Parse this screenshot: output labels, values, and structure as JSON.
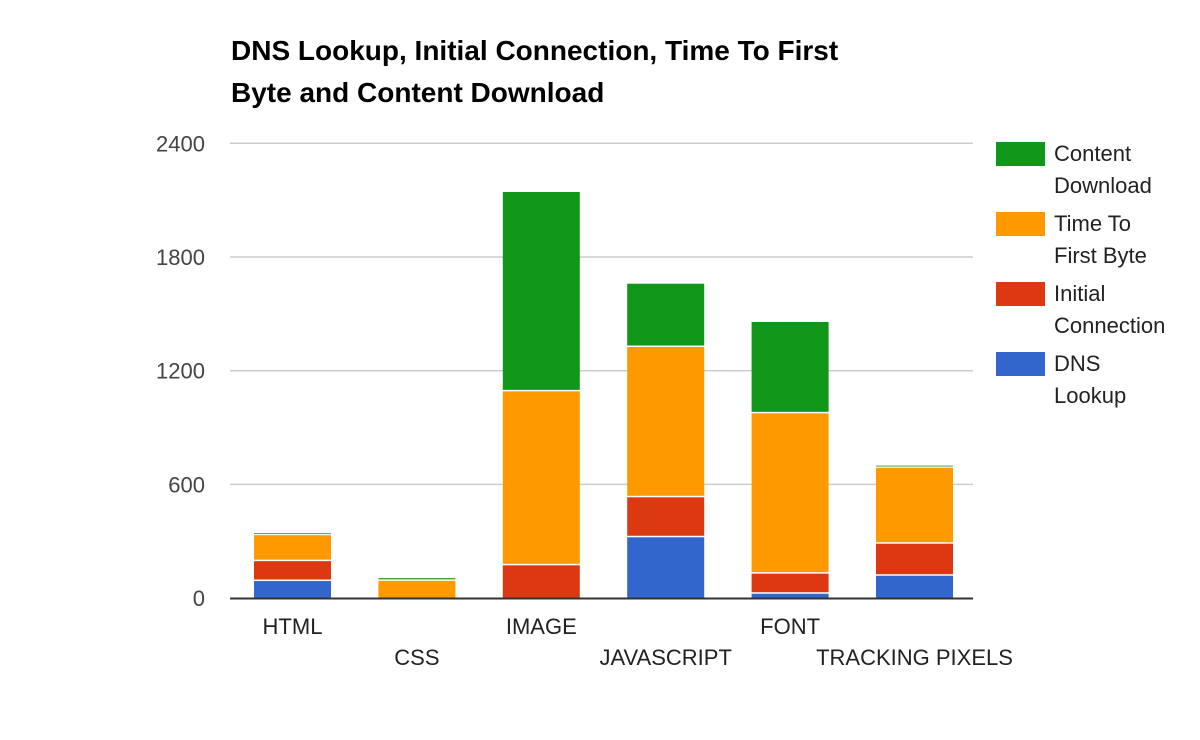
{
  "chart_data": {
    "type": "bar",
    "stacked": true,
    "title": "DNS Lookup, Initial Connection, Time To First Byte and Content Download",
    "title_lines": [
      "DNS Lookup, Initial Connection, Time To First",
      "Byte and Content Download"
    ],
    "xlabel": "",
    "ylabel": "",
    "ylim": [
      0,
      2400
    ],
    "yticks": [
      0,
      600,
      1200,
      1800,
      2400
    ],
    "grid": true,
    "legend_position": "right",
    "categories": [
      "HTML",
      "CSS",
      "IMAGE",
      "JAVASCRIPT",
      "FONT",
      "TRACKING PIXELS"
    ],
    "series": [
      {
        "name": "DNS Lookup",
        "legend_lines": [
          "DNS",
          "Lookup"
        ],
        "color": "#3366cc",
        "values": [
          90,
          0,
          0,
          321,
          23,
          118
        ]
      },
      {
        "name": "Initial Connection",
        "legend_lines": [
          "Initial",
          "Connection"
        ],
        "color": "#dc3912",
        "values": [
          105,
          0,
          173,
          211,
          106,
          169
        ]
      },
      {
        "name": "Time To First Byte",
        "legend_lines": [
          "Time To",
          "First Byte"
        ],
        "color": "#ff9900",
        "values": [
          137,
          91,
          918,
          793,
          846,
          401
        ]
      },
      {
        "name": "Content Download",
        "legend_lines": [
          "Content",
          "Download"
        ],
        "color": "#109618",
        "values": [
          10,
          14,
          1052,
          334,
          482,
          11
        ]
      }
    ],
    "legend_order": [
      "Content Download",
      "Time To First Byte",
      "Initial Connection",
      "DNS Lookup"
    ]
  }
}
